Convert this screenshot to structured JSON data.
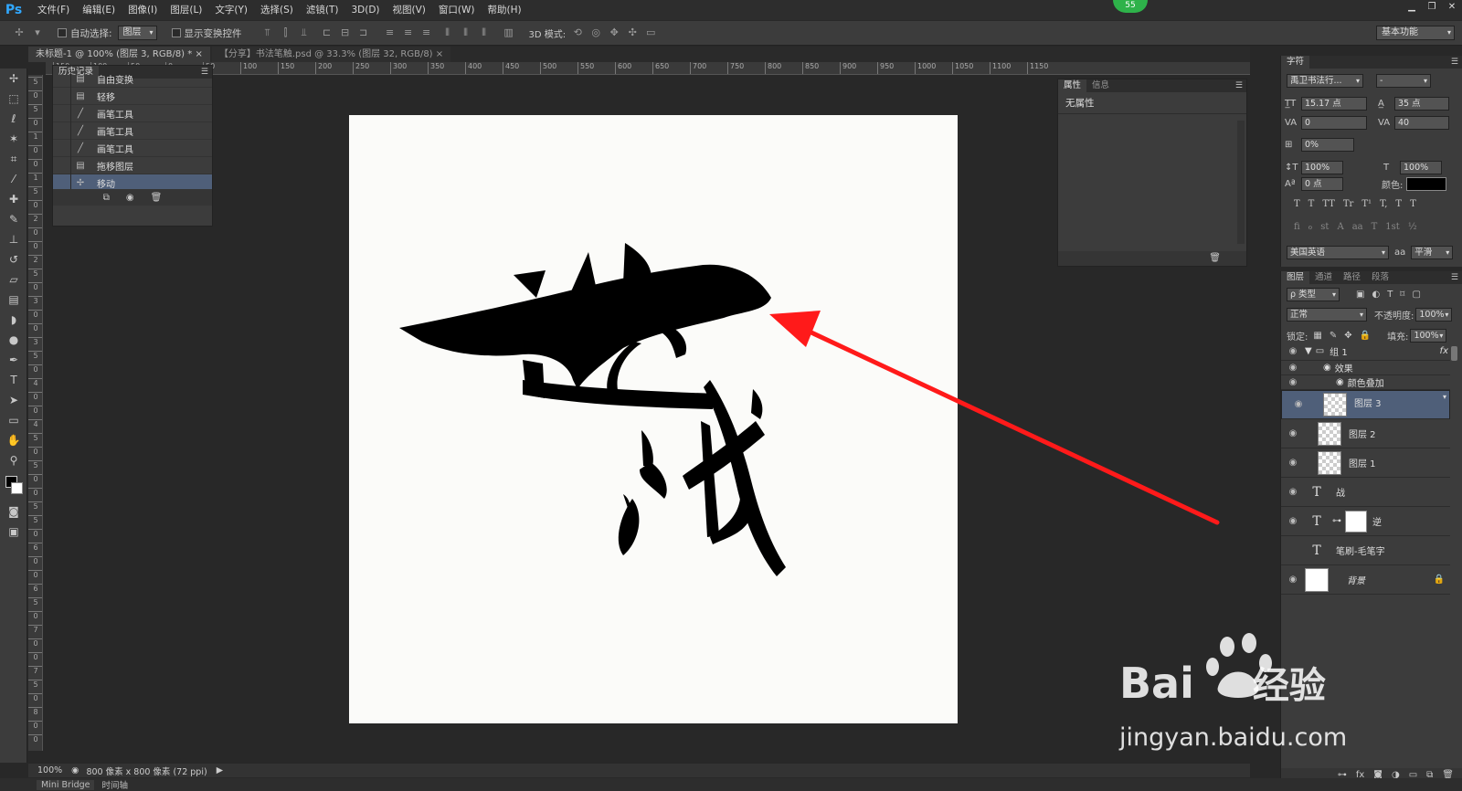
{
  "app": {
    "logo": "Ps",
    "badge": "55"
  },
  "menu": [
    "文件(F)",
    "编辑(E)",
    "图像(I)",
    "图层(L)",
    "文字(Y)",
    "选择(S)",
    "滤镜(T)",
    "3D(D)",
    "视图(V)",
    "窗口(W)",
    "帮助(H)"
  ],
  "options": {
    "auto_select_label": "自动选择:",
    "auto_select_value": "图层",
    "show_transform_label": "显示变换控件",
    "mode3d_label": "3D 模式:",
    "workspace": "基本功能"
  },
  "tabs": [
    {
      "label": "未标题-1 @ 100% (图层 3, RGB/8) *"
    },
    {
      "label": "【分享】书法笔触.psd @ 33.3% (图层 32, RGB/8)"
    }
  ],
  "ruler_top": [
    "150",
    "100",
    "50",
    "0",
    "50",
    "100",
    "150",
    "200",
    "250",
    "300",
    "350",
    "400",
    "450",
    "500",
    "550",
    "600",
    "650",
    "700",
    "750",
    "800",
    "850",
    "900",
    "950",
    "1000",
    "1050",
    "1100",
    "1150"
  ],
  "ruler_left": [
    "5",
    "0",
    "5",
    "0",
    "1",
    "0",
    "0",
    "1",
    "5",
    "0",
    "2",
    "0",
    "0",
    "2",
    "5",
    "0",
    "3",
    "0",
    "0",
    "3",
    "5",
    "0",
    "4",
    "0",
    "0",
    "4",
    "5",
    "0",
    "5",
    "0",
    "0",
    "5",
    "5",
    "0",
    "6",
    "0",
    "0",
    "6",
    "5",
    "0",
    "7",
    "0",
    "0",
    "7",
    "5",
    "0",
    "8",
    "0",
    "0"
  ],
  "history": {
    "title": "历史记录",
    "items": [
      {
        "label": "自由变换",
        "icon": "doc-icon"
      },
      {
        "label": "轻移",
        "icon": "doc-icon"
      },
      {
        "label": "画笔工具",
        "icon": "brush-icon"
      },
      {
        "label": "画笔工具",
        "icon": "brush-icon"
      },
      {
        "label": "画笔工具",
        "icon": "brush-icon"
      },
      {
        "label": "拖移图层",
        "icon": "doc-icon"
      },
      {
        "label": "移动",
        "icon": "move-icon"
      }
    ]
  },
  "properties": {
    "tab1": "属性",
    "tab2": "信息",
    "content": "无属性"
  },
  "character": {
    "title": "字符",
    "font": "禹卫书法行...",
    "style": "-",
    "size": "15.17 点",
    "leading": "35 点",
    "kerning": "0",
    "tracking": "40",
    "tsume": "0%",
    "vscale": "100%",
    "hscale": "100%",
    "baseline": "0 点",
    "color_label": "颜色:",
    "text_styles": [
      "T",
      "T",
      "TT",
      "Tr",
      "T¹",
      "T,",
      "T",
      "T"
    ],
    "opentype": [
      "fi",
      "ℴ",
      "st",
      "A",
      "aa",
      "T",
      "1st",
      "½"
    ],
    "language": "美国英语",
    "aa_label": "aa",
    "aa_value": "平滑"
  },
  "layers_panel": {
    "tabs": [
      "图层",
      "通道",
      "路径",
      "段落"
    ],
    "filter": "ρ 类型",
    "blend": "正常",
    "opacity_label": "不透明度:",
    "opacity": "100%",
    "lock_label": "锁定:",
    "fill_label": "填充:",
    "fill": "100%",
    "layers": [
      {
        "name": "组 1",
        "type": "group",
        "visible": true,
        "fx": "fx"
      },
      {
        "name": "效果",
        "type": "effects-header",
        "visible": true
      },
      {
        "name": "颜色叠加",
        "type": "effect",
        "visible": true
      },
      {
        "name": "图层 3",
        "type": "pixel",
        "visible": true,
        "selected": true
      },
      {
        "name": "图层 2",
        "type": "pixel",
        "visible": true
      },
      {
        "name": "图层 1",
        "type": "pixel",
        "visible": true
      },
      {
        "name": "战",
        "type": "text",
        "visible": true
      },
      {
        "name": "逆",
        "type": "text-mask",
        "visible": true
      },
      {
        "name": "笔刷-毛笔字",
        "type": "text",
        "visible": false
      },
      {
        "name": "背景",
        "type": "background",
        "visible": true,
        "locked": true
      }
    ]
  },
  "status": {
    "zoom": "100%",
    "info": "800 像素 x 800 像素 (72 ppi)"
  },
  "bottom": {
    "tab1": "Mini Bridge",
    "tab2": "时间轴"
  },
  "watermark": {
    "brand": "Bai",
    "brand2": "经验",
    "url": "jingyan.baidu.com"
  },
  "colors": {
    "selection": "#4f5f79",
    "arrow": "#ff1a1a",
    "panel": "#3c3c3c",
    "badge": "#2eb24a"
  }
}
